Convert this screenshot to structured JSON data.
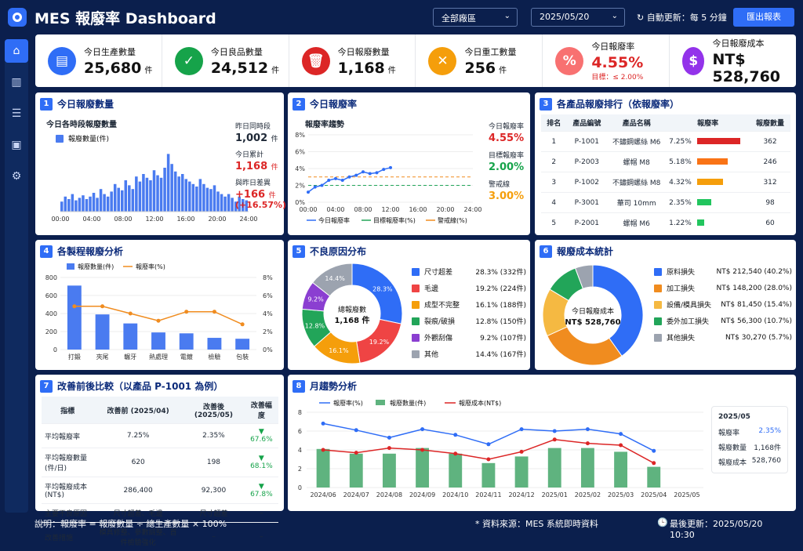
{
  "app": {
    "title": "MES 報廢率 Dashboard",
    "plant": "全部廠區",
    "date": "2025/05/20",
    "refresh": "自動更新：每 5 分鐘",
    "export": "匯出報表"
  },
  "kpis": [
    {
      "label": "今日生產數量",
      "value": "25,680",
      "unit": "件",
      "color": "#2f6df6",
      "icon": "clipboard-icon",
      "glyph": "▤"
    },
    {
      "label": "今日良品數量",
      "value": "24,512",
      "unit": "件",
      "color": "#16a34a",
      "icon": "check-icon",
      "glyph": "✓"
    },
    {
      "label": "今日報廢數量",
      "value": "1,168",
      "unit": "件",
      "color": "#dc2626",
      "icon": "trash-icon",
      "glyph": "🗑"
    },
    {
      "label": "今日重工數量",
      "value": "256",
      "unit": "件",
      "color": "#f59e0b",
      "icon": "tools-icon",
      "glyph": "✕"
    },
    {
      "label": "今日報廢率",
      "value": "4.55%",
      "unit": "",
      "target": "目標：≤ 2.00%",
      "color": "#f87171",
      "icon": "percent-icon",
      "glyph": "%"
    },
    {
      "label": "今日報廢成本",
      "value": "NT$ 528,760",
      "unit": "",
      "color": "#9333ea",
      "icon": "dollar-icon",
      "glyph": "$"
    }
  ],
  "p1": {
    "title": "今日報廢數量",
    "sub": "今日各時段報廢數量",
    "legend": "報廢數量(件)",
    "ticks": [
      "00:00",
      "04:00",
      "08:00",
      "12:00",
      "16:00",
      "20:00",
      "24:00"
    ],
    "ylabel": "",
    "s1": "昨日同時段",
    "v1": "1,002",
    "u1": "件",
    "s2": "今日累計",
    "v2": "1,168",
    "u2": "件",
    "s3": "與昨日差異",
    "v3": "+166",
    "u3": "件",
    "v4": "(+16.57%)"
  },
  "p2": {
    "title": "今日報廢率",
    "sub": "報廢率趨勢",
    "yt": [
      "8%",
      "6%",
      "4%",
      "2%",
      "0%"
    ],
    "ticks": [
      "00:00",
      "04:00",
      "08:00",
      "12:00",
      "16:00",
      "20:00",
      "24:00"
    ],
    "l1": "今日報廢率",
    "l2": "目標報廢率(%)",
    "l3": "警戒線(%)",
    "s1": "今日報廢率",
    "v1": "4.55%",
    "s2": "目標報廢率",
    "v2": "2.00%",
    "s3": "警戒線",
    "v3": "3.00%"
  },
  "p3": {
    "title": "各產品報廢排行（依報廢率）",
    "h": [
      "排名",
      "產品編號",
      "產品名稱",
      "報廢率",
      "報廢數量"
    ],
    "rows": [
      [
        "1",
        "P-1001",
        "不鏽鋼螺絲 M6",
        "7.25%",
        "362"
      ],
      [
        "2",
        "P-2003",
        "螺帽 M8",
        "5.18%",
        "246"
      ],
      [
        "3",
        "P-1002",
        "不鏽鋼螺絲 M8",
        "4.32%",
        "312"
      ],
      [
        "4",
        "P-3001",
        "華司 10mm",
        "2.35%",
        "98"
      ],
      [
        "5",
        "P-2001",
        "螺帽 M6",
        "1.22%",
        "60"
      ]
    ],
    "bars": [
      7.25,
      5.18,
      4.32,
      2.35,
      1.22
    ],
    "barColors": [
      "#dc2626",
      "#f97316",
      "#f59e0b",
      "#22c55e",
      "#22c55e"
    ]
  },
  "p4": {
    "title": "各製程報廢分析",
    "l1": "報廢數量(件)",
    "l2": "報廢率(%)",
    "cats": [
      "打鍛",
      "夾尾",
      "輾牙",
      "熱處理",
      "電鍍",
      "檢驗",
      "包裝"
    ],
    "yl": [
      "800",
      "600",
      "400",
      "200",
      "0"
    ],
    "yr": [
      "8%",
      "6%",
      "4%",
      "2%",
      "0%"
    ]
  },
  "p5": {
    "title": "不良原因分布",
    "center1": "總報廢數",
    "center2": "1,168 件",
    "items": [
      [
        "尺寸超差",
        "28.3% (332件)",
        "#2f6df6",
        "28.3%"
      ],
      [
        "毛邊",
        "19.2% (224件)",
        "#ef4444",
        "19.2%"
      ],
      [
        "成型不完整",
        "16.1% (188件)",
        "#f59e0b",
        "16.1%"
      ],
      [
        "裂痕/破損",
        "12.8% (150件)",
        "#22a559",
        "12.8%"
      ],
      [
        "外觀刮傷",
        "9.2% (107件)",
        "#8b3fd1",
        "9.2%"
      ],
      [
        "其他",
        "14.4% (167件)",
        "#9ca3af",
        "14.4%"
      ]
    ]
  },
  "p6": {
    "title": "報廢成本統計",
    "center1": "今日報廢成本",
    "center2": "NT$ 528,760",
    "items": [
      [
        "原料損失",
        "NT$ 212,540 (40.2%)",
        "#2f6df6"
      ],
      [
        "加工損失",
        "NT$ 148,200 (28.0%)",
        "#f08c1f"
      ],
      [
        "設備/模具損失",
        "NT$ 81,450 (15.4%)",
        "#f5b942"
      ],
      [
        "委外加工損失",
        "NT$ 56,300 (10.7%)",
        "#22a559"
      ],
      [
        "其他損失",
        "NT$ 30,270 (5.7%)",
        "#9ca3af"
      ]
    ]
  },
  "p7": {
    "title": "改善前後比較（以產品 P-1001 為例）",
    "h": [
      "指標",
      "改善前 (2025/04)",
      "改善後 (2025/05)",
      "改善幅度"
    ],
    "rows": [
      [
        "平均報廢率",
        "7.25%",
        "2.35%",
        "▼ 67.6%"
      ],
      [
        "平均報廢數量(件/日)",
        "620",
        "198",
        "▼ 68.1%"
      ],
      [
        "平均報廢成本(NT$)",
        "286,400",
        "92,300",
        "▼ 67.8%"
      ],
      [
        "主要不良原因",
        "尺寸超差、毛邊",
        "尺寸超差",
        "–"
      ],
      [
        "改善措施",
        "模具修整、參數調整、首件檢驗強化",
        "–",
        "–"
      ]
    ]
  },
  "p8": {
    "title": "月趨勢分析",
    "l1": "報廢率(%)",
    "l2": "報廢數量(件)",
    "l3": "報廢成本(NT$)",
    "cats": [
      "2024/06",
      "2024/07",
      "2024/08",
      "2024/09",
      "2024/10",
      "2024/11",
      "2024/12",
      "2025/01",
      "2025/02",
      "2025/03",
      "2025/04",
      "2025/05"
    ],
    "tip": {
      "month": "2025/05",
      "k1": "報廢率",
      "v1": "2.35%",
      "k2": "報廢數量",
      "v2": "1,168件",
      "k3": "報廢成本",
      "v3": "528,760"
    }
  },
  "footer": {
    "note": "說明：報廢率 = 報廢數量 ÷ 總生產數量 × 100%",
    "src": "* 資料來源：MES 系統即時資料",
    "upd": "最後更新：2025/05/20 10:30"
  },
  "chart_data": [
    {
      "type": "bar",
      "title": "今日各時段報廢數量",
      "values": [
        8,
        12,
        10,
        14,
        9,
        11,
        13,
        10,
        12,
        15,
        11,
        18,
        14,
        12,
        16,
        22,
        19,
        17,
        25,
        21,
        18,
        28,
        24,
        30,
        27,
        25,
        33,
        29,
        27,
        35,
        46,
        38,
        32,
        28,
        30,
        26,
        24,
        22,
        20,
        26,
        22,
        19,
        18,
        21,
        16,
        14,
        12,
        14,
        11,
        8,
        12,
        10,
        9
      ]
    },
    {
      "type": "line",
      "title": "報廢率趨勢",
      "x": [
        "00:00",
        "01:00",
        "02:00",
        "03:00",
        "04:00",
        "05:00",
        "06:00",
        "07:00",
        "08:00",
        "09:00",
        "10:00",
        "11:00",
        "12:00"
      ],
      "values": [
        1.2,
        1.8,
        2.0,
        2.6,
        2.8,
        2.6,
        3.0,
        3.2,
        3.6,
        3.4,
        3.5,
        3.9,
        4.1
      ],
      "target": 2.0,
      "warning": 3.0,
      "ylim": [
        0,
        8
      ]
    },
    {
      "type": "bar",
      "title": "各製程報廢分析",
      "categories": [
        "打鍛",
        "夾尾",
        "輾牙",
        "熱處理",
        "電鍍",
        "檢驗",
        "包裝"
      ],
      "series": [
        {
          "name": "報廢數量(件)",
          "values": [
            710,
            390,
            290,
            190,
            180,
            130,
            120
          ]
        },
        {
          "name": "報廢率(%)",
          "values": [
            4.8,
            4.8,
            4.0,
            3.2,
            4.2,
            4.2,
            2.8
          ]
        }
      ]
    },
    {
      "type": "pie",
      "title": "不良原因分布",
      "categories": [
        "尺寸超差",
        "毛邊",
        "成型不完整",
        "裂痕/破損",
        "外觀刮傷",
        "其他"
      ],
      "values": [
        28.3,
        19.2,
        16.1,
        12.8,
        9.2,
        14.4
      ]
    },
    {
      "type": "pie",
      "title": "報廢成本統計",
      "categories": [
        "原料損失",
        "加工損失",
        "設備/模具損失",
        "委外加工損失",
        "其他損失"
      ],
      "values": [
        40.2,
        28.0,
        15.4,
        10.7,
        5.7
      ]
    },
    {
      "type": "bar",
      "title": "月趨勢分析",
      "categories": [
        "2024/06",
        "2024/07",
        "2024/08",
        "2024/09",
        "2024/10",
        "2024/11",
        "2024/12",
        "2025/01",
        "2025/02",
        "2025/03",
        "2025/04",
        "2025/05"
      ],
      "series": [
        {
          "name": "報廢數量(件)",
          "values": [
            4.1,
            3.6,
            3.6,
            4.2,
            3.6,
            2.6,
            3.3,
            4.2,
            4.2,
            3.8,
            2.2,
            0
          ]
        },
        {
          "name": "報廢率(%)",
          "values": [
            6.8,
            6.1,
            5.3,
            6.2,
            5.6,
            4.6,
            6.2,
            6.0,
            6.2,
            5.7,
            3.9,
            0
          ]
        },
        {
          "name": "報廢成本(NT$)",
          "values": [
            4.0,
            3.7,
            4.2,
            4.0,
            3.6,
            3.0,
            3.8,
            5.1,
            4.7,
            4.5,
            2.6,
            0
          ]
        }
      ]
    }
  ]
}
